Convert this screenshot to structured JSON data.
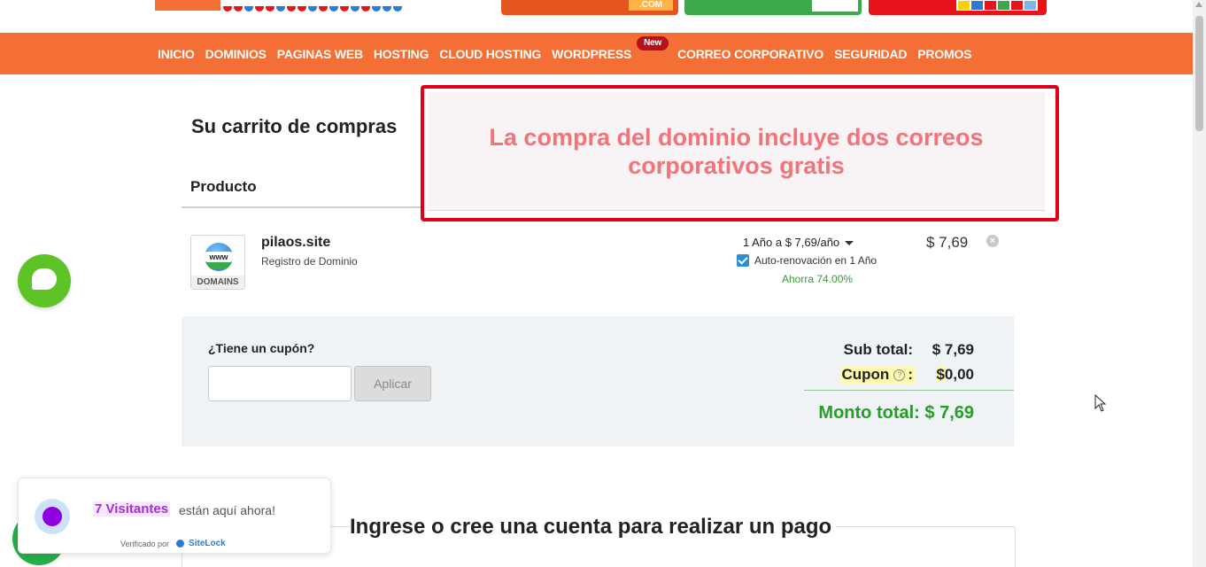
{
  "nav": {
    "items": [
      {
        "label": "INICIO"
      },
      {
        "label": "DOMINIOS"
      },
      {
        "label": "PAGINAS WEB"
      },
      {
        "label": "HOSTING"
      },
      {
        "label": "CLOUD HOSTING"
      },
      {
        "label": "WORDPRESS"
      },
      {
        "label": "CORREO CORPORATIVO"
      },
      {
        "label": "SEGURIDAD"
      },
      {
        "label": "PROMOS"
      }
    ],
    "badge": "New"
  },
  "banners": {
    "banner1_tag": ".COM"
  },
  "cart": {
    "title": "Su carrito de compras",
    "product_header": "Producto"
  },
  "notice": {
    "text": "La compra del dominio incluye dos correos corporativos gratis"
  },
  "item": {
    "icon_label": "DOMAINS",
    "globe_text": "www",
    "name": "pilaos.site",
    "type": "Registro de Dominio",
    "term": "1 Año a $ 7,69/año",
    "auto_renew": "Auto-renovación en 1 Año",
    "savings": "Ahorra 74.00%",
    "price": "$ 7,69"
  },
  "summary": {
    "coupon_label": "¿Tiene un cupón?",
    "coupon_placeholder": "",
    "apply_label": "Aplicar",
    "subtotal_label": "Sub total:",
    "subtotal_value": "$ 7,69",
    "coupon_sum_label": "Cupon",
    "coupon_sum_value_symbol": "$",
    "coupon_sum_value": "0,00",
    "total_label": "Monto total:",
    "total_value": "$ 7,69"
  },
  "login": {
    "title": "Ingrese o cree una cuenta para realizar un pago"
  },
  "visitors": {
    "count": "7 Visitantes",
    "text": "están aquí ahora!",
    "verified": "Verificado por",
    "brand": "SiteLock"
  },
  "colors": {
    "brand_orange": "#f36f36",
    "notice_red": "#e0001a",
    "total_green": "#279d27",
    "chat_green": "#5ec326"
  }
}
